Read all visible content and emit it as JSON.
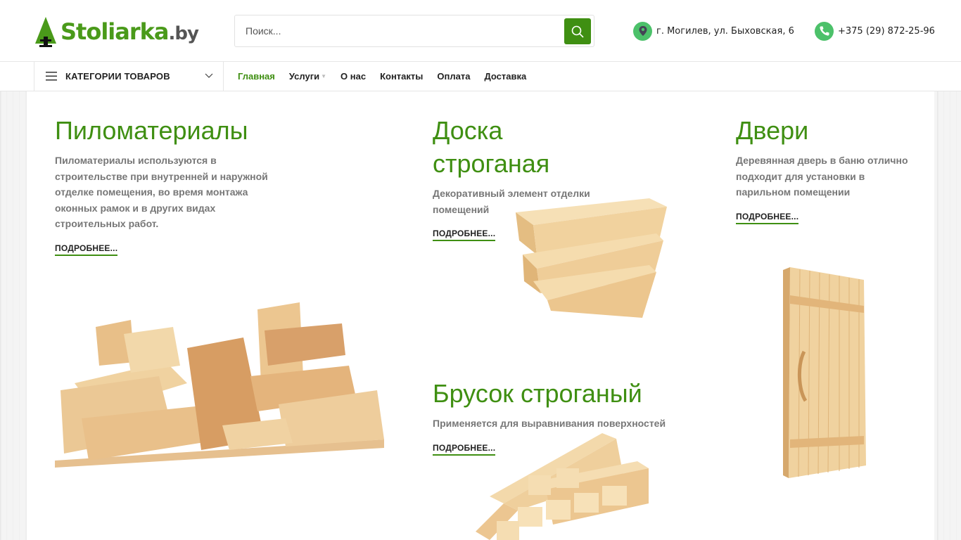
{
  "header": {
    "logo": {
      "main": "Stoliarka",
      "domain": ".by"
    },
    "search": {
      "placeholder": "Поиск..."
    },
    "address": "г. Могилев, ул. Быховская, 6",
    "phone": "+375 (29) 872-25-96"
  },
  "nav": {
    "categories_label": "КАТЕГОРИИ ТОВАРОВ",
    "items": [
      {
        "label": "Главная",
        "active": true
      },
      {
        "label": "Услуги",
        "has_submenu": true
      },
      {
        "label": "О нас"
      },
      {
        "label": "Контакты"
      },
      {
        "label": "Оплата"
      },
      {
        "label": "Доставка"
      }
    ]
  },
  "categories": [
    {
      "title": "Пиломатериалы",
      "desc_lines": [
        "Пиломатериалы используются в",
        "строительстве при внутренней и наружной",
        "отделке помещения, во время монтажа",
        "оконных рамок и в других видах",
        "строительных работ."
      ],
      "more": "ПОДРОБНЕЕ..."
    },
    {
      "title_lines": [
        "Доска",
        "строганая"
      ],
      "desc_lines": [
        "Декоративный элемент отделки",
        "помещений"
      ],
      "more": "ПОДРОБНЕЕ..."
    },
    {
      "title": "Двери",
      "desc_lines": [
        "Деревянная дверь в баню отлично",
        "подходит для установки в",
        "парильном помещении"
      ],
      "more": "ПОДРОБНЕЕ..."
    },
    {
      "title": "Брусок строганый",
      "desc_lines": [
        "Применяется для выравнивания поверхностей"
      ],
      "more": "ПОДРОБНЕЕ..."
    }
  ],
  "colors": {
    "accent": "#3f8f12",
    "text": "#222222",
    "muted": "#777777",
    "wood_light": "#f1d6a8",
    "wood_mid": "#e3b77c",
    "wood_dark": "#c98f52"
  },
  "icons": [
    "logo-tree-icon",
    "search-icon",
    "location-pin-icon",
    "phone-icon",
    "hamburger-icon",
    "chevron-down-icon"
  ]
}
